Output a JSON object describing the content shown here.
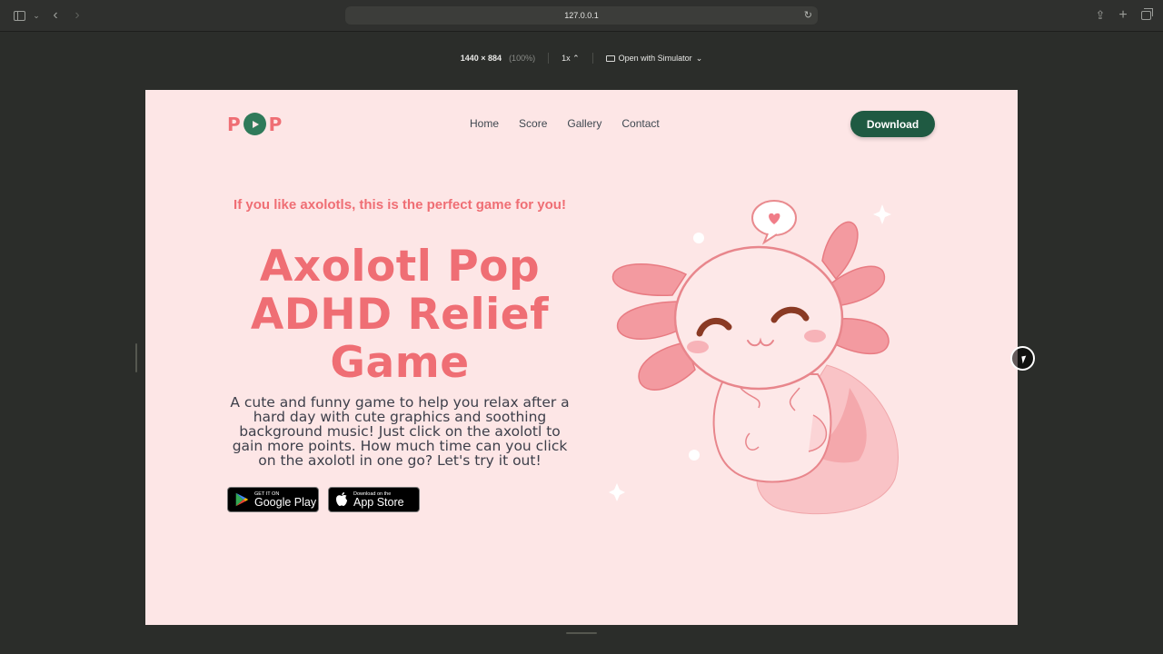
{
  "browser": {
    "url": "127.0.0.1",
    "responsive": {
      "dimensions": "1440 × 884",
      "zoom": "(100%)",
      "scale": "1x",
      "simulator": "Open with Simulator"
    }
  },
  "site": {
    "logo": {
      "left_letter": "P",
      "right_letter": "P"
    },
    "nav": [
      "Home",
      "Score",
      "Gallery",
      "Contact"
    ],
    "download_label": "Download",
    "tagline": "If you like axolotls, this is the perfect game for you!",
    "headline_lines": [
      "Axolotl Pop",
      "ADHD Relief",
      "Game"
    ],
    "description": "A cute and funny game to help you relax after a hard day with cute graphics and soothing background music! Just click on the axolotl to gain more points. How much time can you click on the axolotl in one go? Let's try it out!",
    "google_play": {
      "small": "GET IT ON",
      "big": "Google Play"
    },
    "app_store": {
      "small": "Download on the",
      "big": "App Store"
    }
  },
  "colors": {
    "brand_pink": "#ef6e74",
    "brand_green": "#1f5a42",
    "page_bg": "#fde6e6"
  }
}
